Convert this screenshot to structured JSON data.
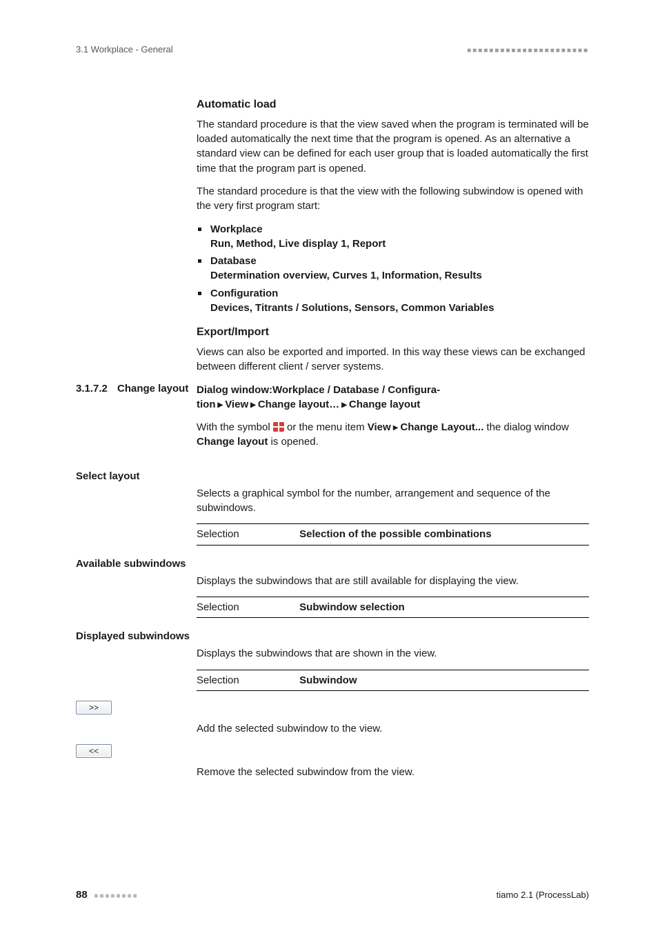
{
  "header": {
    "left": "3.1 Workplace - General",
    "right_dots": "■■■■■■■■■■■■■■■■■■■■■■"
  },
  "s1": {
    "h": "Automatic load",
    "p1": "The standard procedure is that the view saved when the program is terminated will be loaded automatically the next time that the program is opened. As an alternative a standard view can be defined for each user group that is loaded automatically the first time that the program part is opened.",
    "p2": "The standard procedure is that the view with the following subwindow is opened with the very first program start:",
    "li1_t": "Workplace",
    "li1_b": "Run, Method, Live display 1, Report",
    "li2_t": "Database",
    "li2_b": "Determination overview, Curves 1, Information, Results",
    "li3_t": "Configuration",
    "li3_b": "Devices, Titrants / Solutions, Sensors, Common Variables"
  },
  "s2": {
    "h": "Export/Import",
    "p": "Views can also be exported and imported. In this way these views can be exchanged between different client / server systems."
  },
  "sect": {
    "no": "3.1.7.2",
    "title": "Change layout",
    "dlg1": "Dialog window:Workplace / Database / Configura-",
    "dlg2_a": "tion",
    "dlg2_b": "View",
    "dlg2_c": "Change layout…",
    "dlg2_d": "Change layout",
    "p1a": "With the symbol ",
    "p1b": " or the menu item ",
    "p1c": "View",
    "p1d": "Change Layout...",
    "p1e": " the dialog window ",
    "p1f": "Change layout",
    "p1g": " is opened."
  },
  "f1": {
    "head": "Select layout",
    "p": "Selects a graphical symbol for the number, arrangement and sequence of the subwindows.",
    "sel_lbl": "Selection",
    "sel_val": "Selection of the possible combinations"
  },
  "f2": {
    "head": "Available subwindows",
    "p": "Displays the subwindows that are still available for displaying the view.",
    "sel_lbl": "Selection",
    "sel_val": "Subwindow selection"
  },
  "f3": {
    "head": "Displayed subwindows",
    "p": "Displays the subwindows that are shown in the view.",
    "sel_lbl": "Selection",
    "sel_val": "Subwindow"
  },
  "btn_add": ">>",
  "btn_add_desc": "Add the selected subwindow to the view.",
  "btn_rm": "<<",
  "btn_rm_desc": "Remove the selected subwindow from the view.",
  "footer": {
    "page": "88",
    "dots": "■■■■■■■■",
    "right": "tiamo 2.1 (ProcessLab)"
  }
}
